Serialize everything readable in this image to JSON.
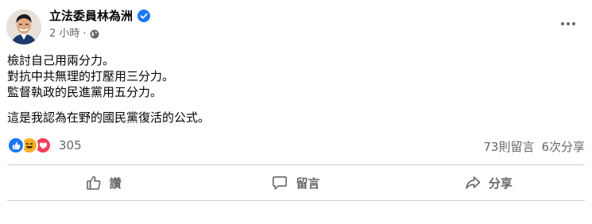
{
  "post": {
    "author": "立法委員林為洲",
    "time": "2 小時",
    "dot": "·",
    "lines": [
      "檢討自己用兩分力。",
      "對抗中共無理的打壓用三分力。",
      "監督執政的民進黨用五分力。"
    ],
    "closing": "這是我認為在野的國民黨復活的公式。"
  },
  "stats": {
    "reaction_count": "305",
    "comments": "73則留言",
    "shares": "6次分享"
  },
  "actions": {
    "like": "讚",
    "comment": "留言",
    "share": "分享"
  },
  "icons": {
    "verified": "verified-badge-icon",
    "privacy": "globe-icon",
    "more": "more-options-icon",
    "reactions": [
      "like-icon",
      "haha-icon",
      "love-icon"
    ]
  },
  "colors": {
    "brand": "#1877f2",
    "secondary_text": "#65676b",
    "haha": "#f7b125",
    "love": "#f33e58"
  }
}
